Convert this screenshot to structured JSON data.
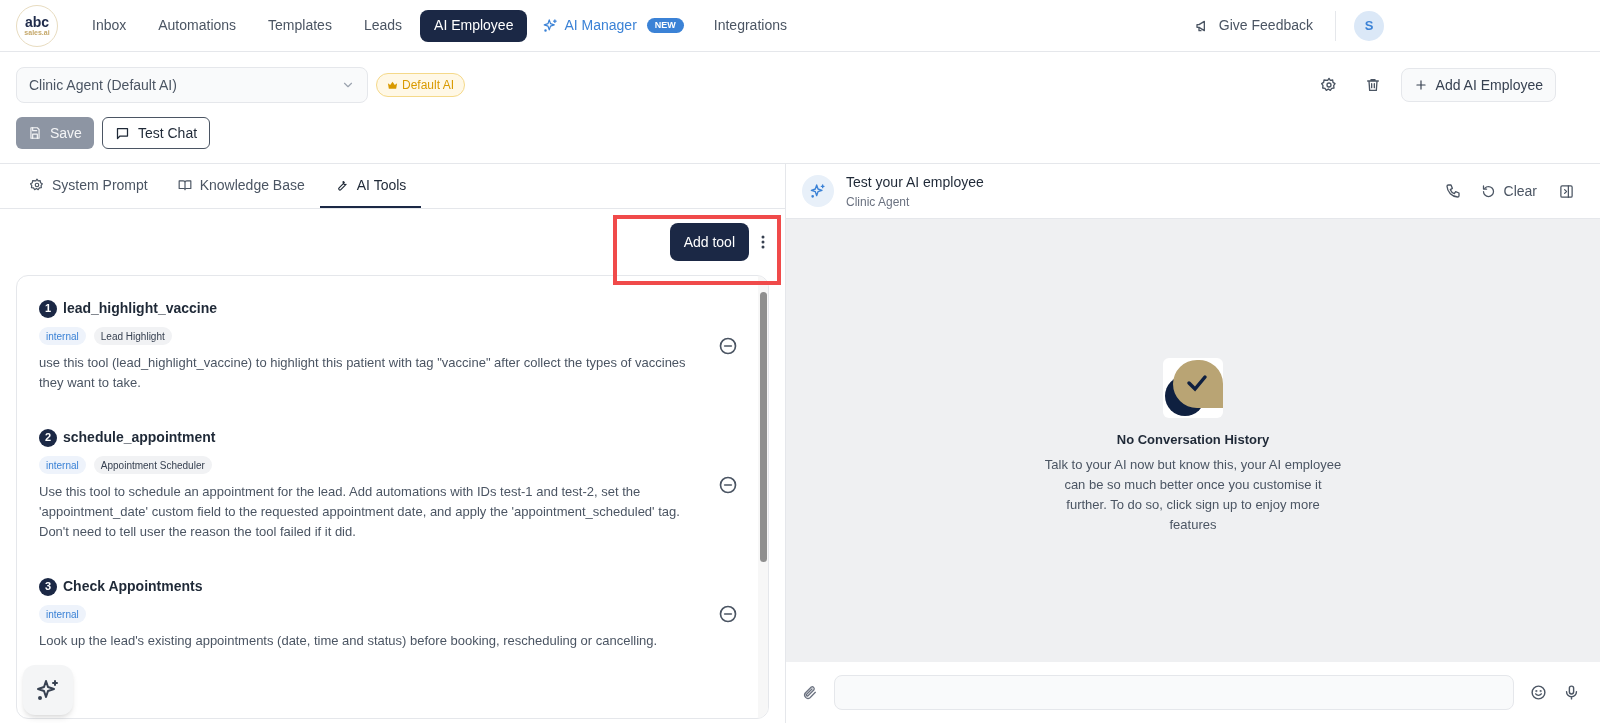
{
  "nav": {
    "items": [
      {
        "label": "Inbox",
        "selected": false,
        "kind": "plain"
      },
      {
        "label": "Automations",
        "selected": false,
        "kind": "plain"
      },
      {
        "label": "Templates",
        "selected": false,
        "kind": "plain"
      },
      {
        "label": "Leads",
        "selected": false,
        "kind": "plain"
      },
      {
        "label": "AI Employee",
        "selected": true,
        "kind": "plain"
      },
      {
        "label": "AI Manager",
        "selected": false,
        "kind": "special",
        "badge": "NEW"
      },
      {
        "label": "Integrations",
        "selected": false,
        "kind": "plain"
      }
    ],
    "feedback": "Give Feedback",
    "avatar": "S",
    "logo_top": "abc",
    "logo_bottom": "sales.ai"
  },
  "agent_select": {
    "value": "Clinic Agent (Default AI)",
    "badge": "Default AI"
  },
  "add_employee": "Add AI Employee",
  "save": {
    "label": "Save",
    "disabled": true
  },
  "test_chat": "Test Chat",
  "tabs": [
    {
      "label": "System Prompt",
      "selected": false
    },
    {
      "label": "Knowledge Base",
      "selected": false
    },
    {
      "label": "AI Tools",
      "selected": true
    }
  ],
  "add_tool": "Add tool",
  "tools": [
    {
      "number": "1",
      "name": "lead_highlight_vaccine",
      "tags": [
        {
          "label": "internal",
          "kind": "scope"
        },
        {
          "label": "Lead Highlight",
          "kind": "type"
        }
      ],
      "description": "use this tool (lead_highlight_vaccine) to highlight this patient with tag \"vaccine\" after collect the types of vaccines they want to take."
    },
    {
      "number": "2",
      "name": "schedule_appointment",
      "tags": [
        {
          "label": "internal",
          "kind": "scope"
        },
        {
          "label": "Appointment Scheduler",
          "kind": "type"
        }
      ],
      "description": "Use this tool to schedule an appointment for the lead. Add automations with IDs test-1 and test-2, set the 'appointment_date' custom field to the requested appointment date, and apply the 'appointment_scheduled' tag. Don't need to tell user the reason the tool failed if it did."
    },
    {
      "number": "3",
      "name": "Check Appointments",
      "tags": [
        {
          "label": "internal",
          "kind": "scope"
        }
      ],
      "description": "Look up the lead's existing appointments (date, time and status) before booking, rescheduling or cancelling."
    }
  ],
  "chat": {
    "title": "Test your AI employee",
    "subtitle": "Clinic Agent",
    "clear": "Clear",
    "empty_title": "No Conversation History",
    "empty_text": "Talk to your AI now but know this, your AI employee can be so much better once you customise it further. To do so, click sign up to enjoy more features"
  }
}
